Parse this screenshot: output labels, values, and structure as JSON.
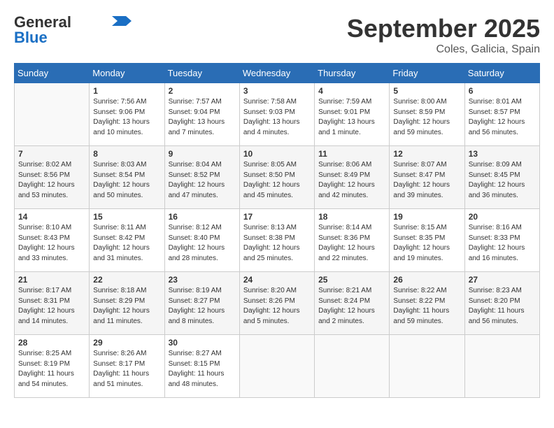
{
  "header": {
    "logo_line1": "General",
    "logo_line2": "Blue",
    "month_year": "September 2025",
    "location": "Coles, Galicia, Spain"
  },
  "weekdays": [
    "Sunday",
    "Monday",
    "Tuesday",
    "Wednesday",
    "Thursday",
    "Friday",
    "Saturday"
  ],
  "weeks": [
    [
      {
        "day": "",
        "info": ""
      },
      {
        "day": "1",
        "info": "Sunrise: 7:56 AM\nSunset: 9:06 PM\nDaylight: 13 hours\nand 10 minutes."
      },
      {
        "day": "2",
        "info": "Sunrise: 7:57 AM\nSunset: 9:04 PM\nDaylight: 13 hours\nand 7 minutes."
      },
      {
        "day": "3",
        "info": "Sunrise: 7:58 AM\nSunset: 9:03 PM\nDaylight: 13 hours\nand 4 minutes."
      },
      {
        "day": "4",
        "info": "Sunrise: 7:59 AM\nSunset: 9:01 PM\nDaylight: 13 hours\nand 1 minute."
      },
      {
        "day": "5",
        "info": "Sunrise: 8:00 AM\nSunset: 8:59 PM\nDaylight: 12 hours\nand 59 minutes."
      },
      {
        "day": "6",
        "info": "Sunrise: 8:01 AM\nSunset: 8:57 PM\nDaylight: 12 hours\nand 56 minutes."
      }
    ],
    [
      {
        "day": "7",
        "info": "Sunrise: 8:02 AM\nSunset: 8:56 PM\nDaylight: 12 hours\nand 53 minutes."
      },
      {
        "day": "8",
        "info": "Sunrise: 8:03 AM\nSunset: 8:54 PM\nDaylight: 12 hours\nand 50 minutes."
      },
      {
        "day": "9",
        "info": "Sunrise: 8:04 AM\nSunset: 8:52 PM\nDaylight: 12 hours\nand 47 minutes."
      },
      {
        "day": "10",
        "info": "Sunrise: 8:05 AM\nSunset: 8:50 PM\nDaylight: 12 hours\nand 45 minutes."
      },
      {
        "day": "11",
        "info": "Sunrise: 8:06 AM\nSunset: 8:49 PM\nDaylight: 12 hours\nand 42 minutes."
      },
      {
        "day": "12",
        "info": "Sunrise: 8:07 AM\nSunset: 8:47 PM\nDaylight: 12 hours\nand 39 minutes."
      },
      {
        "day": "13",
        "info": "Sunrise: 8:09 AM\nSunset: 8:45 PM\nDaylight: 12 hours\nand 36 minutes."
      }
    ],
    [
      {
        "day": "14",
        "info": "Sunrise: 8:10 AM\nSunset: 8:43 PM\nDaylight: 12 hours\nand 33 minutes."
      },
      {
        "day": "15",
        "info": "Sunrise: 8:11 AM\nSunset: 8:42 PM\nDaylight: 12 hours\nand 31 minutes."
      },
      {
        "day": "16",
        "info": "Sunrise: 8:12 AM\nSunset: 8:40 PM\nDaylight: 12 hours\nand 28 minutes."
      },
      {
        "day": "17",
        "info": "Sunrise: 8:13 AM\nSunset: 8:38 PM\nDaylight: 12 hours\nand 25 minutes."
      },
      {
        "day": "18",
        "info": "Sunrise: 8:14 AM\nSunset: 8:36 PM\nDaylight: 12 hours\nand 22 minutes."
      },
      {
        "day": "19",
        "info": "Sunrise: 8:15 AM\nSunset: 8:35 PM\nDaylight: 12 hours\nand 19 minutes."
      },
      {
        "day": "20",
        "info": "Sunrise: 8:16 AM\nSunset: 8:33 PM\nDaylight: 12 hours\nand 16 minutes."
      }
    ],
    [
      {
        "day": "21",
        "info": "Sunrise: 8:17 AM\nSunset: 8:31 PM\nDaylight: 12 hours\nand 14 minutes."
      },
      {
        "day": "22",
        "info": "Sunrise: 8:18 AM\nSunset: 8:29 PM\nDaylight: 12 hours\nand 11 minutes."
      },
      {
        "day": "23",
        "info": "Sunrise: 8:19 AM\nSunset: 8:27 PM\nDaylight: 12 hours\nand 8 minutes."
      },
      {
        "day": "24",
        "info": "Sunrise: 8:20 AM\nSunset: 8:26 PM\nDaylight: 12 hours\nand 5 minutes."
      },
      {
        "day": "25",
        "info": "Sunrise: 8:21 AM\nSunset: 8:24 PM\nDaylight: 12 hours\nand 2 minutes."
      },
      {
        "day": "26",
        "info": "Sunrise: 8:22 AM\nSunset: 8:22 PM\nDaylight: 11 hours\nand 59 minutes."
      },
      {
        "day": "27",
        "info": "Sunrise: 8:23 AM\nSunset: 8:20 PM\nDaylight: 11 hours\nand 56 minutes."
      }
    ],
    [
      {
        "day": "28",
        "info": "Sunrise: 8:25 AM\nSunset: 8:19 PM\nDaylight: 11 hours\nand 54 minutes."
      },
      {
        "day": "29",
        "info": "Sunrise: 8:26 AM\nSunset: 8:17 PM\nDaylight: 11 hours\nand 51 minutes."
      },
      {
        "day": "30",
        "info": "Sunrise: 8:27 AM\nSunset: 8:15 PM\nDaylight: 11 hours\nand 48 minutes."
      },
      {
        "day": "",
        "info": ""
      },
      {
        "day": "",
        "info": ""
      },
      {
        "day": "",
        "info": ""
      },
      {
        "day": "",
        "info": ""
      }
    ]
  ]
}
